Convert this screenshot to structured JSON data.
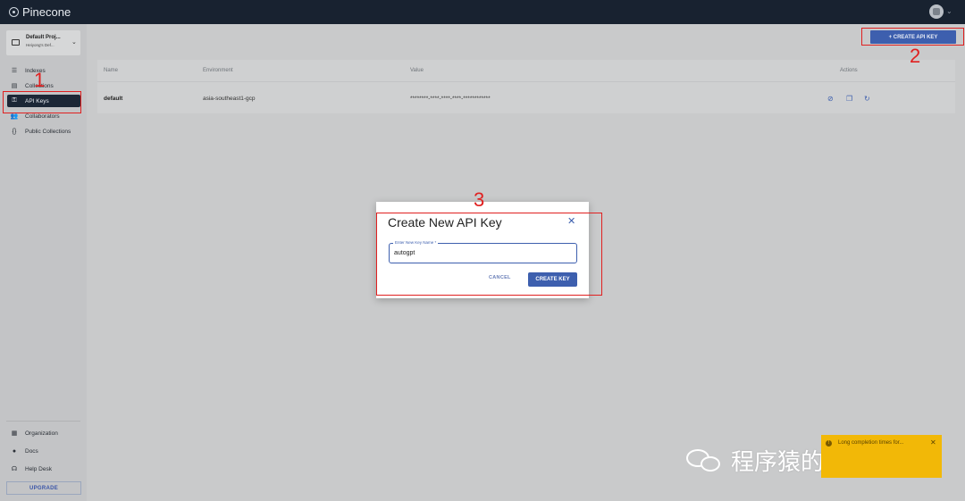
{
  "app": {
    "name": "Pinecone"
  },
  "project": {
    "name": "Default Proj...",
    "subtitle": "Heiyong's Def..."
  },
  "sidebar": {
    "items": [
      {
        "label": "Indexes",
        "icon": "list-icon"
      },
      {
        "label": "Collections",
        "icon": "collection-icon"
      },
      {
        "label": "API Keys",
        "icon": "key-icon"
      },
      {
        "label": "Collaborators",
        "icon": "people-icon"
      },
      {
        "label": "Public Collections",
        "icon": "braces-icon"
      }
    ],
    "bottom_items": [
      {
        "label": "Organization",
        "icon": "building-icon"
      },
      {
        "label": "Docs",
        "icon": "help-icon"
      },
      {
        "label": "Help Desk",
        "icon": "helpdesk-icon"
      }
    ],
    "upgrade_label": "UPGRADE"
  },
  "toolbar": {
    "create_api_key_label": "+ CREATE API KEY"
  },
  "table": {
    "headers": [
      "Name",
      "Environment",
      "Value",
      "Actions"
    ],
    "rows": [
      {
        "name": "default",
        "environment": "asia-southeast1-gcp",
        "value": "********-****-****-****-************"
      }
    ]
  },
  "modal": {
    "title": "Create New API Key",
    "field_label": "Enter New Key Name *",
    "field_value": "autogpt",
    "cancel_label": "CANCEL",
    "create_label": "CREATE KEY"
  },
  "annotations": {
    "one": "1",
    "two": "2",
    "three": "3"
  },
  "toast": {
    "message": "Long completion times for..."
  },
  "watermark": {
    "text": "程序猿的Code日常"
  },
  "colors": {
    "accent": "#3d5fae",
    "topbar": "#182230",
    "annotation": "#e02020",
    "toast": "#f2b807"
  }
}
